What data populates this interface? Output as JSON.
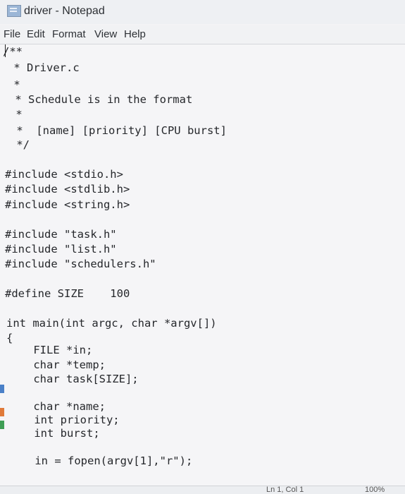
{
  "window": {
    "title": "driver - Notepad",
    "icon": "notepad-icon"
  },
  "menu": {
    "file": "File",
    "edit": "Edit",
    "format": "Format",
    "view": "View",
    "help": "Help"
  },
  "editor": {
    "lines": [
      "/**",
      " * Driver.c",
      " *",
      " * Schedule is in the format",
      " *",
      " *  [name] [priority] [CPU burst]",
      " */",
      "",
      "#include <stdio.h>",
      "#include <stdlib.h>",
      "#include <string.h>",
      "",
      "#include \"task.h\"",
      "#include \"list.h\"",
      "#include \"schedulers.h\"",
      "",
      "#define SIZE    100",
      "",
      "int main(int argc, char *argv[])",
      "{",
      "    FILE *in;",
      "    char *temp;",
      "    char task[SIZE];",
      "",
      "    char *name;",
      "    int priority;",
      "    int burst;",
      "",
      "    in = fopen(argv[1],\"r\");"
    ]
  },
  "status": {
    "position": "Ln 1, Col 1",
    "zoom": "100%"
  },
  "colors": {
    "editor_background": "#f5f5f7",
    "text": "#25272b",
    "chrome": "#eef0f3"
  }
}
